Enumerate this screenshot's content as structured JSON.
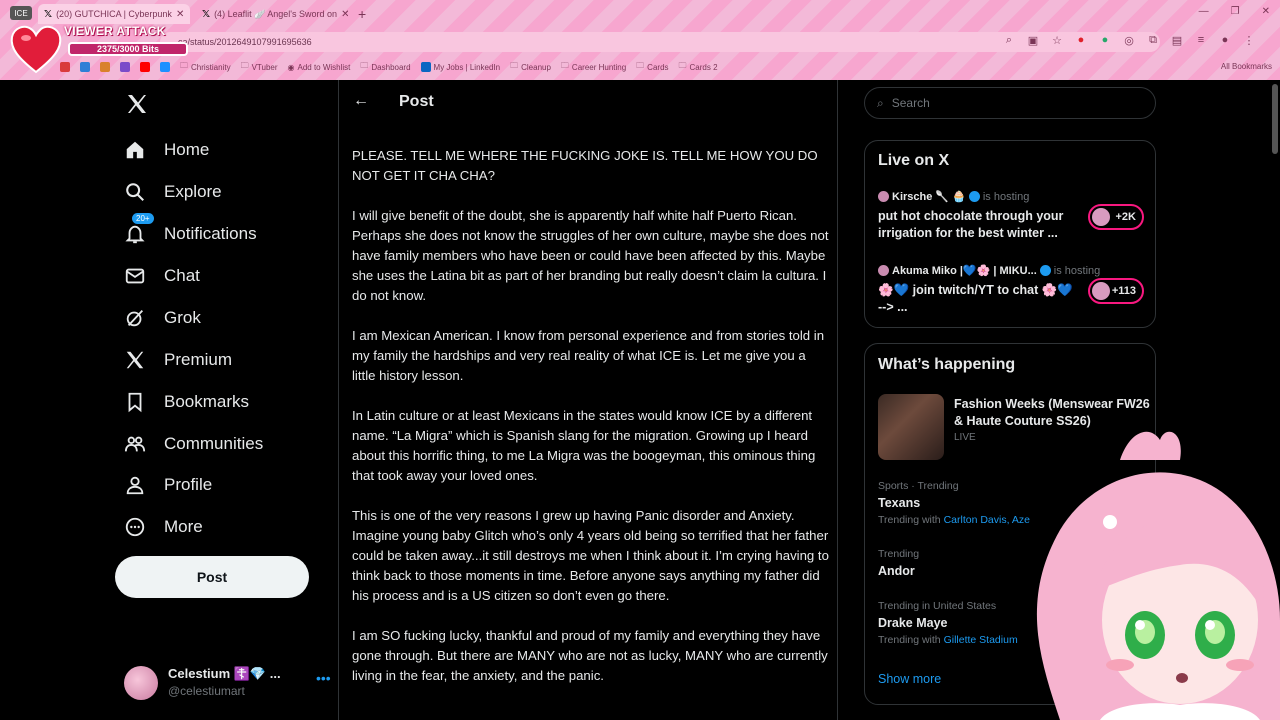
{
  "browser": {
    "ice_badge": "ICE",
    "tabs": [
      {
        "label": "(20) GUTCHICA | Cyberpunk",
        "active": true
      },
      {
        "label": "(4) Leaflit 🪽 Angel's Sword on",
        "active": false
      }
    ],
    "url": "ca/status/2012649107991695636",
    "bookmarks": [
      "Christianity",
      "VTuber",
      "Add to Wishlist",
      "Dashboard",
      "My Jobs | LinkedIn",
      "Cleanup",
      "Career Hunting",
      "Cards",
      "Cards 2"
    ],
    "all_bookmarks": "All Bookmarks"
  },
  "overlay": {
    "title": "VIEWER ATTACK",
    "bits": "2375/3000 Bits"
  },
  "nav": {
    "items": [
      {
        "label": "Home",
        "icon": "home-icon"
      },
      {
        "label": "Explore",
        "icon": "search-icon"
      },
      {
        "label": "Notifications",
        "icon": "bell-icon",
        "badge": "20+"
      },
      {
        "label": "Chat",
        "icon": "mail-icon"
      },
      {
        "label": "Grok",
        "icon": "grok-icon"
      },
      {
        "label": "Premium",
        "icon": "x-icon"
      },
      {
        "label": "Bookmarks",
        "icon": "bookmark-icon"
      },
      {
        "label": "Communities",
        "icon": "people-icon"
      },
      {
        "label": "Profile",
        "icon": "person-icon"
      },
      {
        "label": "More",
        "icon": "more-icon"
      }
    ],
    "post_button": "Post",
    "account": {
      "name": "Celestium ☦️💎 ...",
      "handle": "@celestiumart"
    }
  },
  "main": {
    "title": "Post",
    "paragraphs": [
      "PLEASE. TELL ME WHERE THE FUCKING JOKE IS. TELL ME HOW YOU DO NOT GET IT CHA CHA?",
      "I will give benefit of the doubt, she is apparently half white half Puerto Rican. Perhaps she does not know the struggles of her own culture, maybe she does not have family members who have been or could have been affected by this. Maybe she uses the Latina bit as part of her branding but really doesn’t claim la cultura. I do not know.",
      "I am Mexican American. I know from personal experience and from stories told in my family the hardships and very real reality of what ICE is. Let me give you a little history lesson.",
      "In Latin culture or at least Mexicans in the states would know ICE by a different name. “La Migra” which is Spanish slang for the migration. Growing up I heard about this horrific thing, to me La Migra was the boogeyman, this ominous thing that took away your loved ones.",
      "This is one of the very reasons I grew up having Panic disorder and Anxiety. Imagine young baby Glitch who’s only 4 years old being so terrified that her father could be taken away...it still destroys me when I think about it. I’m crying having to think back to those moments in time. Before anyone says anything my father did his process and is a US citizen so don’t even go there.",
      "I am SO fucking lucky, thankful and proud of my family and everything they have gone through. But there are MANY who are not as lucky, MANY who are currently living in the fear, the anxiety, and the panic."
    ]
  },
  "right": {
    "search_placeholder": "Search",
    "live": {
      "title": "Live on X",
      "items": [
        {
          "host": "Kirsche 🥄 🧁",
          "hosting": "is hosting",
          "desc": "put hot chocolate through your irrigation for the best winter ...",
          "count": "+2K"
        },
        {
          "host": "Akuma Miko |💙🌸 | MIKU...",
          "hosting": "is hosting",
          "desc": "🌸💙 join twitch/YT to chat 🌸💙 --> ...",
          "count": "+113"
        }
      ]
    },
    "happening": {
      "title": "What’s happening",
      "featured": {
        "title": "Fashion Weeks (Menswear FW26 & Haute Couture SS26)",
        "meta": "LIVE"
      },
      "trends": [
        {
          "meta": "Sports · Trending",
          "name": "Texans",
          "with_label": "Trending with",
          "with": "Carlton Davis, Aze"
        },
        {
          "meta": "Trending",
          "name": "Andor",
          "with_label": "",
          "with": ""
        },
        {
          "meta": "Trending in United States",
          "name": "Drake Maye",
          "with_label": "Trending with",
          "with": "Gillette Stadium"
        }
      ],
      "show_more": "Show more"
    }
  }
}
